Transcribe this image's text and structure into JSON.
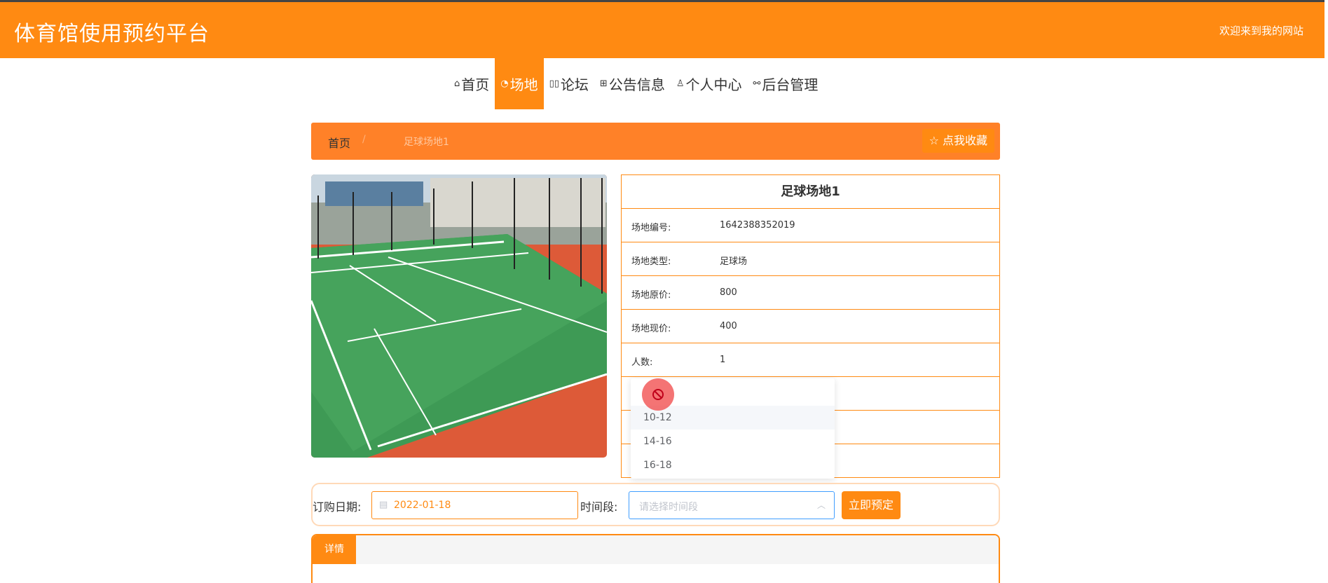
{
  "header": {
    "site_title": "体育馆使用预约平台",
    "welcome": "欢迎来到我的网站"
  },
  "nav": {
    "items": [
      {
        "label": "首页",
        "icon": "home-icon",
        "glyph": "⌂"
      },
      {
        "label": "场地",
        "icon": "gauge-icon",
        "glyph": "◔",
        "active": true
      },
      {
        "label": "论坛",
        "icon": "book-icon",
        "glyph": "▯▯"
      },
      {
        "label": "公告信息",
        "icon": "grid-icon",
        "glyph": "⊞"
      },
      {
        "label": "个人中心",
        "icon": "user-icon",
        "glyph": "♙"
      },
      {
        "label": "后台管理",
        "icon": "link-icon",
        "glyph": "⚯"
      }
    ]
  },
  "breadcrumb": {
    "home": "首页",
    "separator": "/",
    "current": "足球场地1",
    "favorite_label": "☆ 点我收藏"
  },
  "venue": {
    "title": "足球场地1",
    "rows": [
      {
        "label": "场地编号:",
        "value": "1642388352019"
      },
      {
        "label": "场地类型:",
        "value": "足球场"
      },
      {
        "label": "场地原价:",
        "value": "800"
      },
      {
        "label": "场地现价:",
        "value": "400"
      },
      {
        "label": "人数:",
        "value": "1"
      },
      {
        "label": "",
        "value": ""
      },
      {
        "label": "",
        "value": ""
      },
      {
        "label": "",
        "value": ""
      }
    ]
  },
  "dropdown": {
    "options": [
      "10-12",
      "14-16",
      "16-18"
    ]
  },
  "booking": {
    "date_label": "订购日期:",
    "date_value": "2022-01-18",
    "time_label": "时间段:",
    "time_placeholder": "请选择时间段",
    "book_button": "立即预定"
  },
  "detail": {
    "tab_label": "详情"
  },
  "colors": {
    "brand": "#ff8a12",
    "breadcrumb_bg": "#ff8128"
  }
}
